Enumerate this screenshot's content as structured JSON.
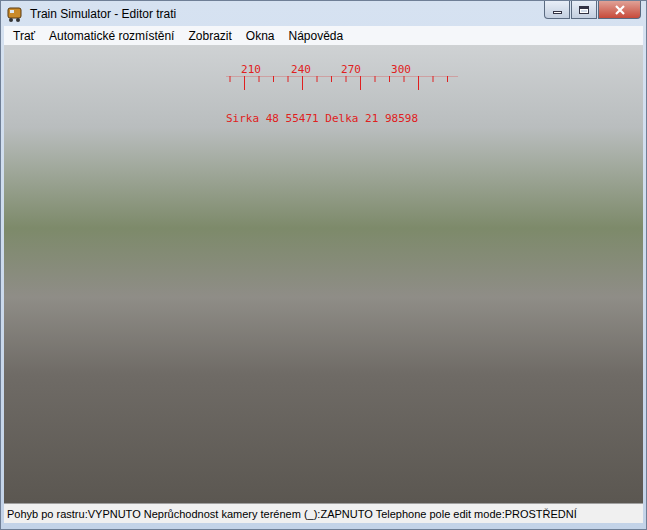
{
  "window": {
    "title": "Train Simulator - Editor trati"
  },
  "menu": [
    {
      "label": "Trať"
    },
    {
      "label": "Automatické rozmístění"
    },
    {
      "label": "Zobrazit"
    },
    {
      "label": "Okna"
    },
    {
      "label": "Nápověda"
    }
  ],
  "viewport": {
    "compass_ticks": [
      "210",
      "240",
      "270",
      "300"
    ],
    "coordinates": "Sirka 48 55471 Delka 21 98598"
  },
  "status_bar": "Pohyb po rastru:VYPNUTO Neprůchodnost kamery terénem (_):ZAPNUTO Telephone pole edit mode:PROSTŘEDNÍ"
}
